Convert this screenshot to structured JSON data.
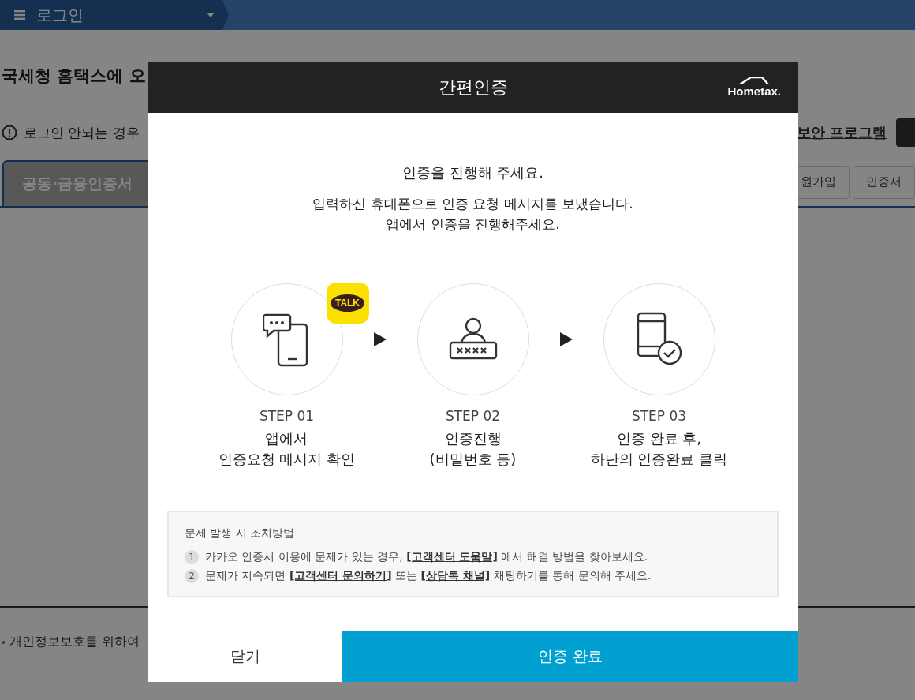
{
  "top_bar": {
    "title": "로그인"
  },
  "page": {
    "headline": "국세청 홈택스에 오",
    "notice": "로그인 안되는 경우",
    "security_link": "보안 프로그램",
    "tabs": [
      {
        "label": "공동·금융인증서",
        "selected": true
      }
    ],
    "side_buttons": [
      "원가입",
      "인증서"
    ],
    "footer_note": "개인정보보호를 위하여"
  },
  "modal": {
    "title": "간편인증",
    "logo": "Hometax.",
    "heading": "인증을 진행해 주세요.",
    "message": [
      "입력하신 휴대폰으로 인증 요청 메시지를 보냈습니다.",
      "앱에서 인증을 진행해주세요."
    ],
    "steps": [
      {
        "kind": "message",
        "step": "STEP 01",
        "desc": [
          "앱에서",
          "인증요청 메시지 확인"
        ],
        "badge": "TALK"
      },
      {
        "kind": "password",
        "step": "STEP 02",
        "desc": [
          "인증진행",
          "(비밀번호 등)"
        ]
      },
      {
        "kind": "complete",
        "step": "STEP 03",
        "desc": [
          "인증 완료 후,",
          "하단의 인증완료 클릭"
        ]
      }
    ],
    "help": {
      "title": "문제 발생 시 조치방법",
      "items": [
        {
          "num": "1",
          "parts": [
            {
              "text": "카카오 인증서 이용에 문제가 있는 경우, ",
              "link": false
            },
            {
              "text": "[고객센터 도움말]",
              "link": true
            },
            {
              "text": " 에서 해결 방법을 찾아보세요.",
              "link": false
            }
          ]
        },
        {
          "num": "2",
          "parts": [
            {
              "text": "문제가 지속되면 ",
              "link": false
            },
            {
              "text": "[고객센터 문의하기]",
              "link": true
            },
            {
              "text": " 또는 ",
              "link": false
            },
            {
              "text": "[상담톡 채널]",
              "link": true
            },
            {
              "text": " 채팅하기를 통해 문의해 주세요.",
              "link": false
            }
          ]
        }
      ]
    },
    "buttons": [
      {
        "label": "닫기",
        "kind": "secondary"
      },
      {
        "label": "인증 완료",
        "kind": "primary"
      }
    ]
  }
}
